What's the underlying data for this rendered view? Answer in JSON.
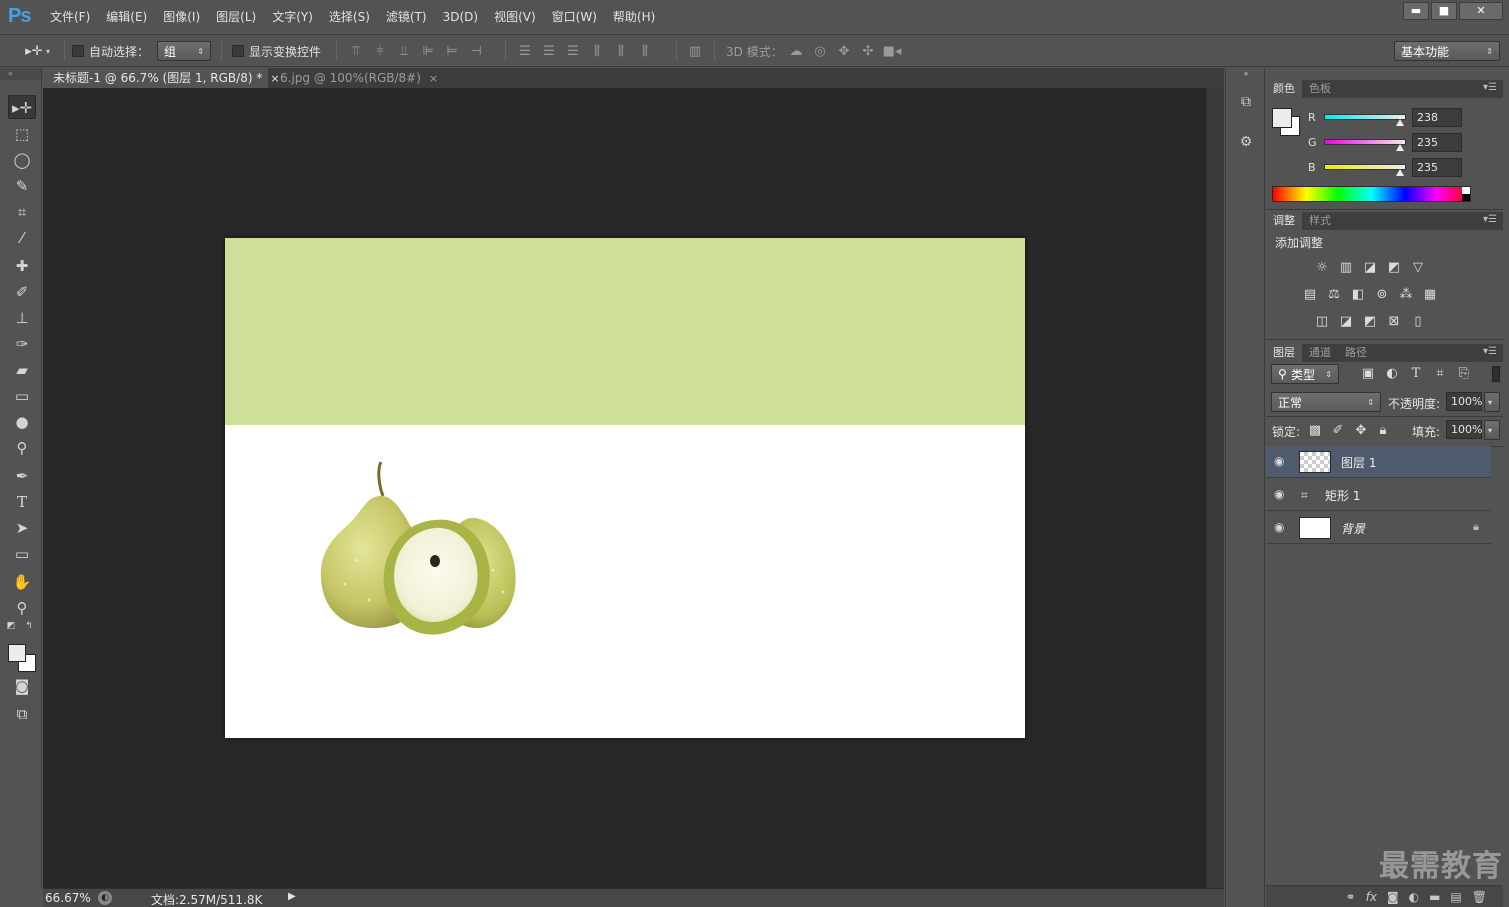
{
  "app": {
    "logo": "Ps"
  },
  "menu": [
    "文件(F)",
    "编辑(E)",
    "图像(I)",
    "图层(L)",
    "文字(Y)",
    "选择(S)",
    "滤镜(T)",
    "3D(D)",
    "视图(V)",
    "窗口(W)",
    "帮助(H)"
  ],
  "window_controls": {
    "minimize": "▬",
    "maximize": "■",
    "close": "✕"
  },
  "options_bar": {
    "auto_select_label": "自动选择：",
    "auto_select_value": "组",
    "show_transform_label": "显示变换控件",
    "mode_3d_label": "3D 模式：",
    "workspace": "基本功能"
  },
  "tabs": [
    {
      "label": "未标题-1 @ 66.7% (图层 1, RGB/8) *",
      "close": "×"
    },
    {
      "label": "6.jpg @ 100%(RGB/8#)",
      "close": "×"
    }
  ],
  "status": {
    "zoom": "66.67%",
    "doc_info": "文档:2.57M/511.8K"
  },
  "color_panel": {
    "tabs": [
      "颜色",
      "色板"
    ],
    "r_label": "R",
    "r": "238",
    "g_label": "G",
    "g": "235",
    "b_label": "B",
    "b": "235",
    "foreground": "#eeebeb",
    "background": "#ffffff"
  },
  "adjustments_panel": {
    "tabs": [
      "调整",
      "样式"
    ],
    "title": "添加调整"
  },
  "layers_panel": {
    "tabs": [
      "图层",
      "通道",
      "路径"
    ],
    "filter_kind": "类型",
    "blend_mode": "正常",
    "opacity_label": "不透明度:",
    "opacity": "100%",
    "lock_label": "锁定:",
    "fill_label": "填充:",
    "fill": "100%",
    "layers": [
      {
        "name": "图层 1",
        "selected": true
      },
      {
        "name": "矩形 1",
        "selected": false
      },
      {
        "name": "背景",
        "selected": false
      }
    ]
  },
  "document": {
    "rect_color": "#cddf99",
    "canvas_color": "#ffffff"
  },
  "watermark": "最需教育"
}
